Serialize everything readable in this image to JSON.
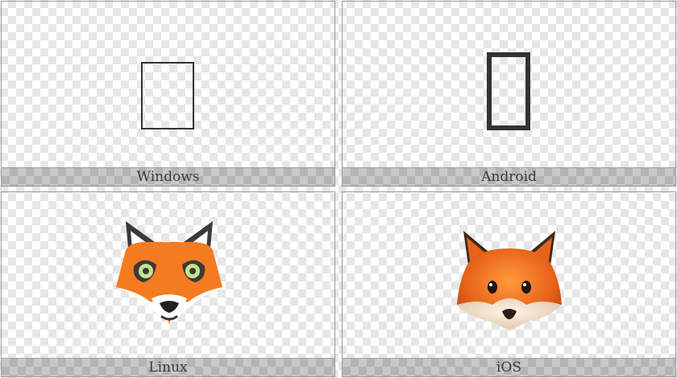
{
  "platforms": [
    {
      "name": "Windows",
      "glyph": "tofu-thin"
    },
    {
      "name": "Android",
      "glyph": "tofu-bold"
    },
    {
      "name": "Linux",
      "glyph": "fox-face-flat"
    },
    {
      "name": "iOS",
      "glyph": "fox-face-3d"
    }
  ],
  "colors": {
    "fox_orange": "#f47b20",
    "fox_dark": "#3a3a3a",
    "eye_green": "#c6e48b"
  }
}
